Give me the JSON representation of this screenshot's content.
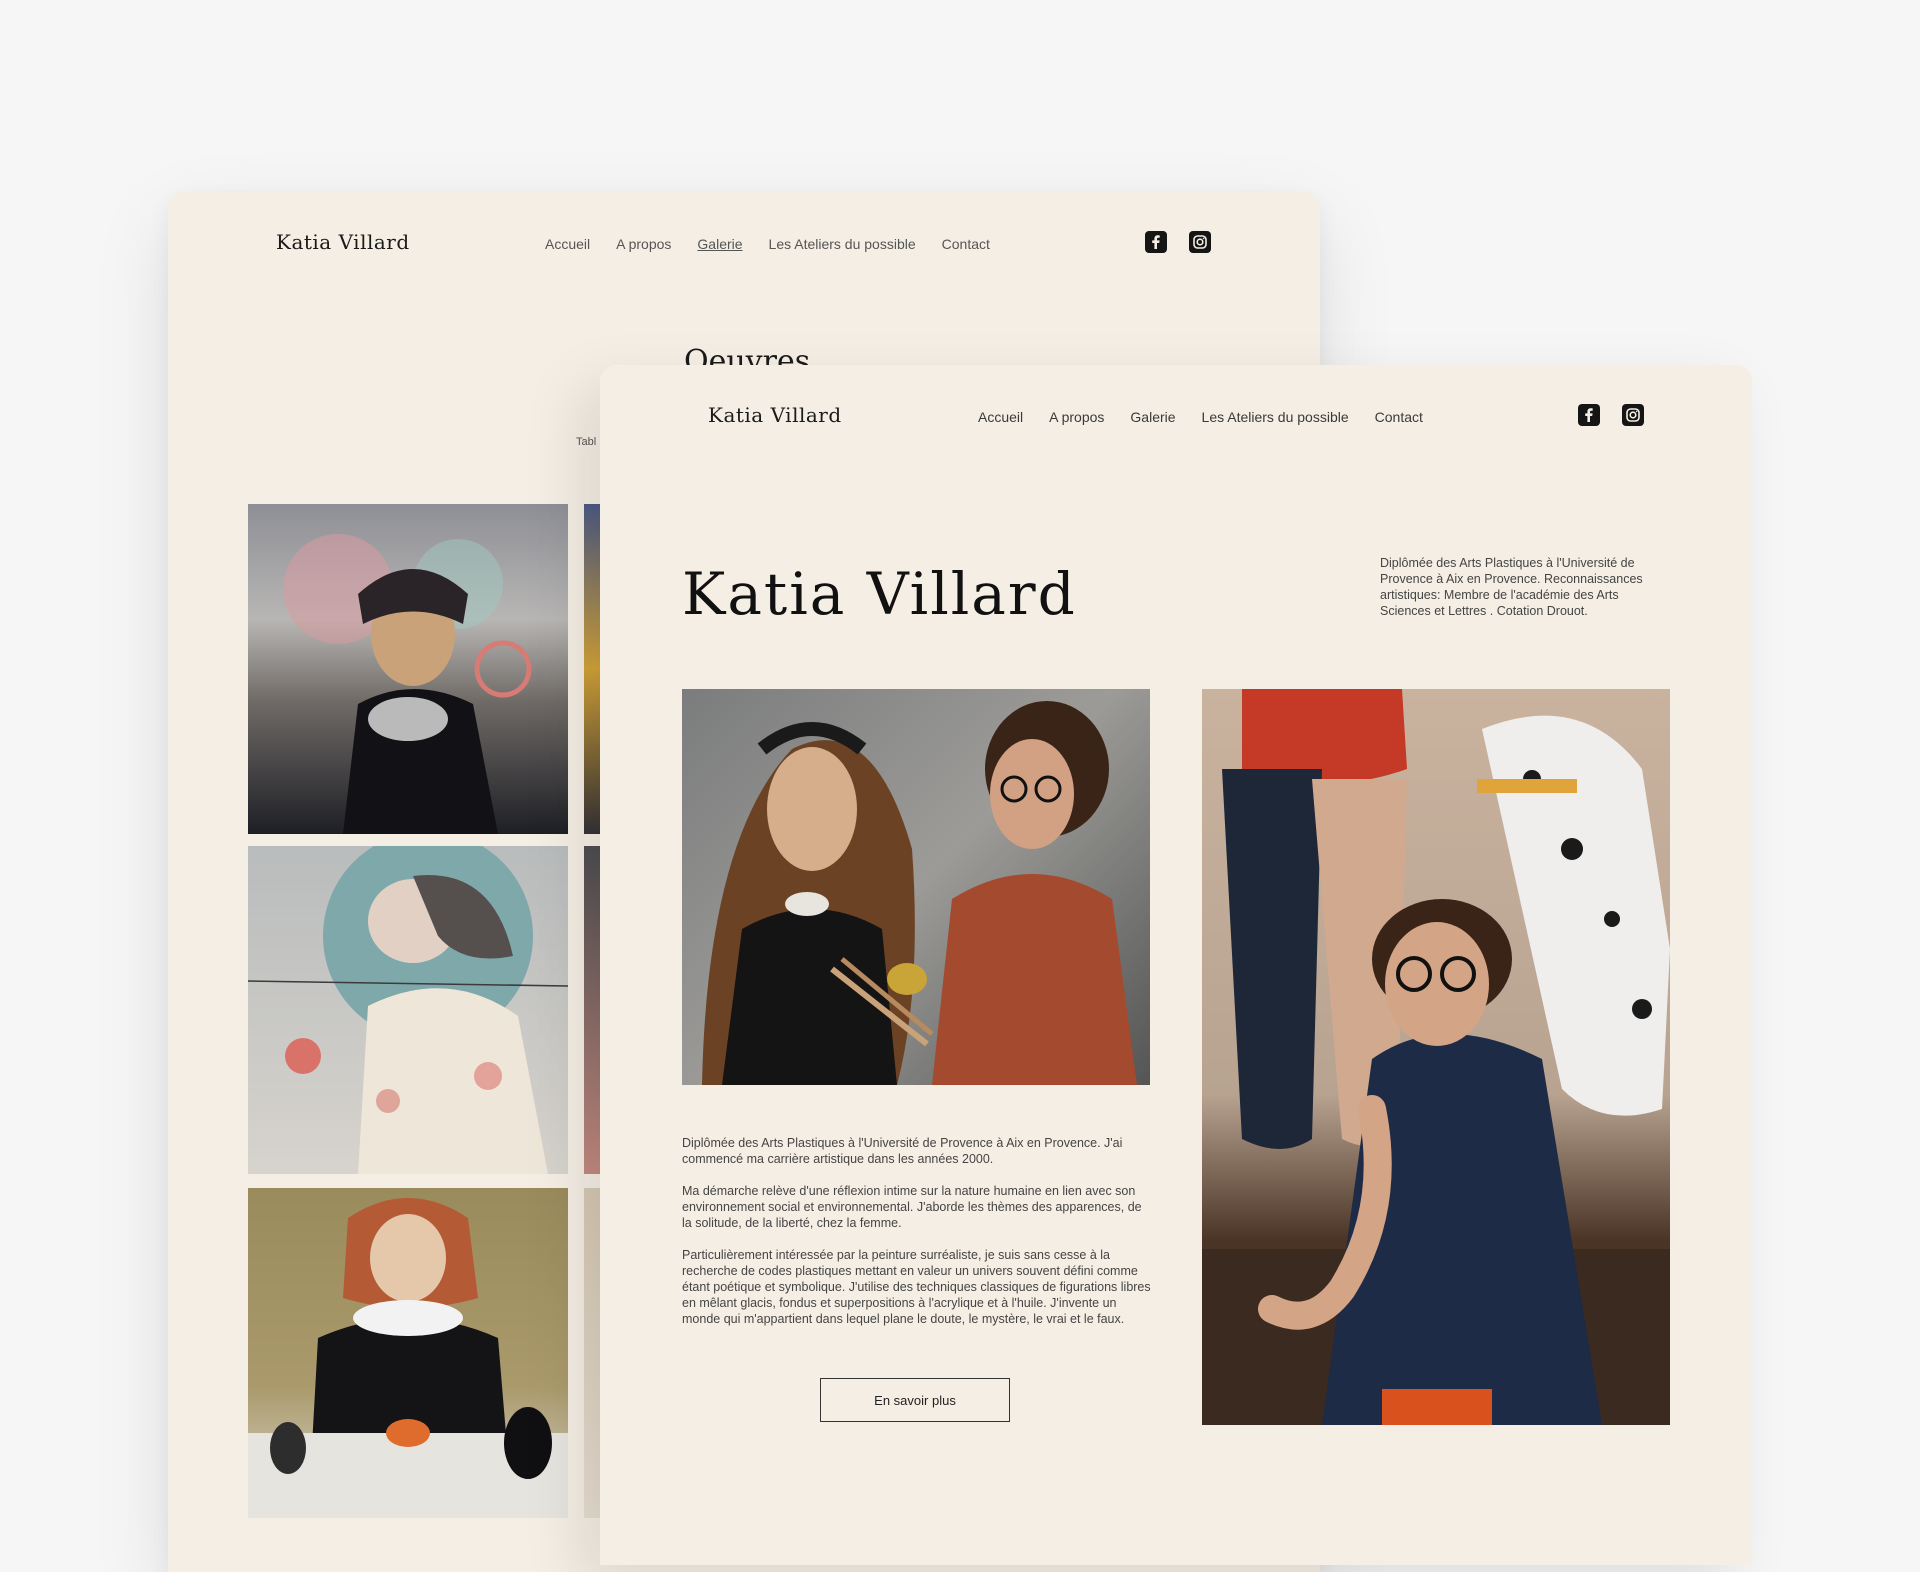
{
  "site": {
    "logo": "Katia Villard",
    "nav": [
      "Accueil",
      "A propos",
      "Galerie",
      "Les Ateliers du possible",
      "Contact"
    ]
  },
  "back_page": {
    "heading": "Oeuvres",
    "subtitle": "Tabl"
  },
  "front_page": {
    "title": "Katia Villard",
    "bio": "Diplômée des Arts Plastiques à l'Université de Provence à Aix en Provence. Reconnaissances artistiques: Membre de l'académie des Arts Sciences et Lettres . Cotation Drouot.",
    "paragraphs": [
      "Diplômée des Arts Plastiques à l'Université de Provence à Aix en Provence. J'ai commencé ma carrière artistique dans les années 2000.",
      "Ma démarche relève d'une réflexion intime sur la nature humaine en lien avec son environnement social et environnemental. J'aborde les thèmes des apparences, de la solitude, de la liberté, chez la femme.",
      "Particulièrement intéressée par la peinture surréaliste, je suis sans cesse à la recherche de codes plastiques mettant en valeur un univers souvent défini comme étant poétique et symbolique. J'utilise des techniques classiques de figurations libres en mêlant glacis, fondus et superpositions à l'acrylique et à l'huile. J'invente un monde qui m'appartient dans lequel plane le doute, le mystère, le vrai et le faux."
    ],
    "button_label": "En savoir plus"
  },
  "icons": [
    "facebook-icon",
    "instagram-icon"
  ],
  "colors": {
    "page_bg": "#f5eee4",
    "outer_bg": "#f6f6f6",
    "text": "#2b2b2b"
  }
}
